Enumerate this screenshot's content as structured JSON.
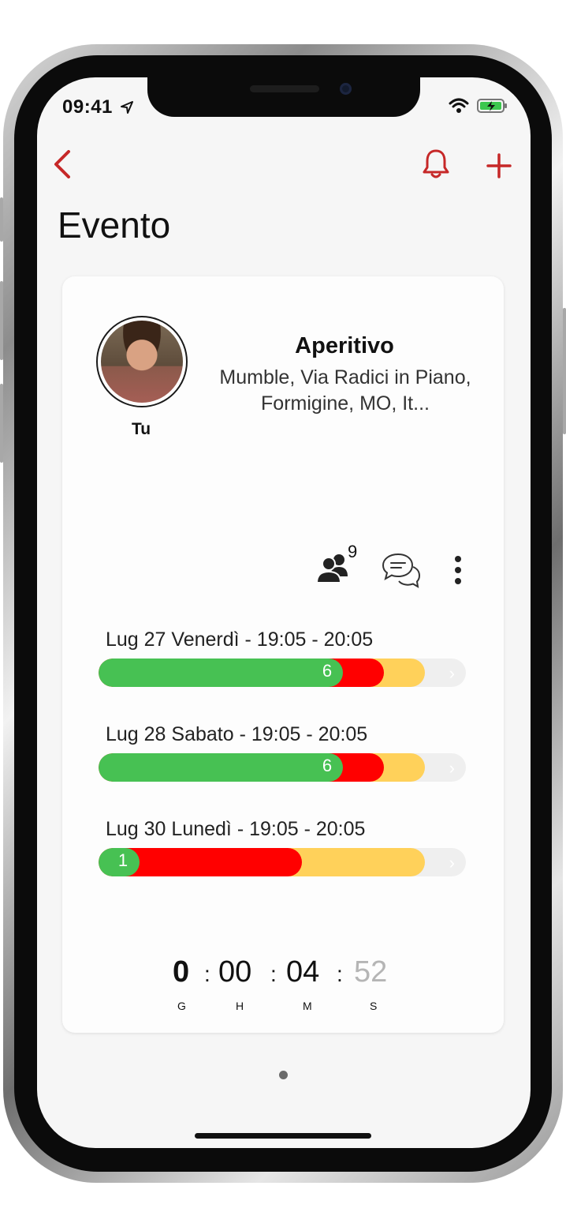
{
  "status_bar": {
    "time": "09:41"
  },
  "nav": {
    "back_icon": "chevron-left-icon",
    "bell_icon": "bell-icon",
    "add_icon": "plus-icon"
  },
  "page": {
    "title": "Evento"
  },
  "event": {
    "owner_label": "Tu",
    "name": "Aperitivo",
    "address": "Mumble, Via Radici in Piano, Formigine, MO, It..."
  },
  "actions": {
    "participants_count": "9"
  },
  "slots": [
    {
      "label": "Lug 27 Venerdì - 19:05 - 20:05",
      "count": "6"
    },
    {
      "label": "Lug 28 Sabato - 19:05 - 20:05",
      "count": "6"
    },
    {
      "label": "Lug 30 Lunedì - 19:05 - 20:05",
      "count": "1"
    }
  ],
  "countdown": {
    "days": "0",
    "hours": "00",
    "minutes": "04",
    "seconds": "52",
    "days_unit": "G",
    "hours_unit": "H",
    "minutes_unit": "M",
    "seconds_unit": "S",
    "separator": ":"
  },
  "colors": {
    "accent": "#c62828",
    "green": "#47c153",
    "red": "#ff0000",
    "yellow": "#ffd15a"
  }
}
